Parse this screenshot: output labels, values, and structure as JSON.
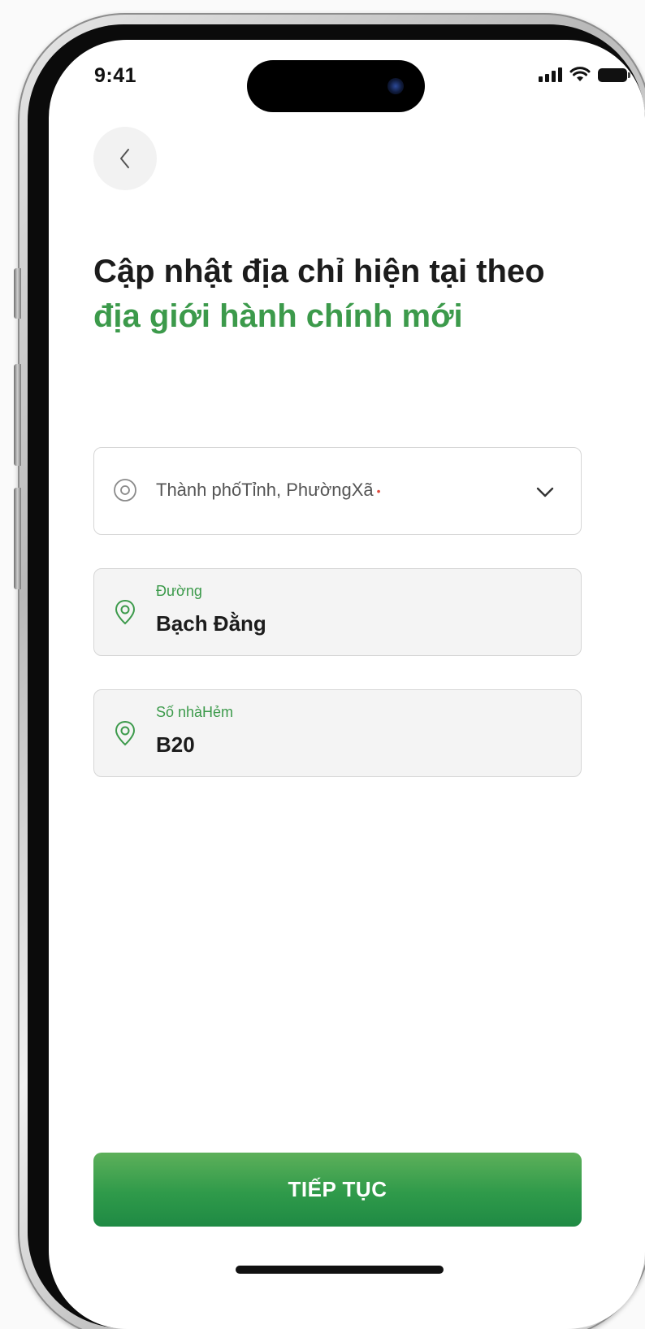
{
  "status_bar": {
    "time": "9:41",
    "icons": [
      "cellular-signal-icon",
      "wifi-icon",
      "battery-icon"
    ]
  },
  "navigation": {
    "back_icon": "chevron-left-icon"
  },
  "header": {
    "title_dark": "Cập nhật địa chỉ hiện tại theo ",
    "title_highlight": "địa giới hành chính mới"
  },
  "form": {
    "city_select": {
      "placeholder": "Thành phốTỉnh, PhườngXã",
      "required_marker": "•",
      "icon": "location-pin-icon",
      "dropdown_icon": "chevron-down-icon"
    },
    "street": {
      "label": "Đường",
      "value": "Bạch Đằng",
      "icon": "location-pin-icon"
    },
    "house_number": {
      "label": "Số nhàHẻm",
      "value": "B20",
      "icon": "location-pin-icon"
    }
  },
  "actions": {
    "continue_label": "TIẾP TỤC"
  },
  "colors": {
    "accent_green": "#3c9a4b",
    "button_green": "#2f9a4a",
    "required_red": "#e04b3f"
  }
}
